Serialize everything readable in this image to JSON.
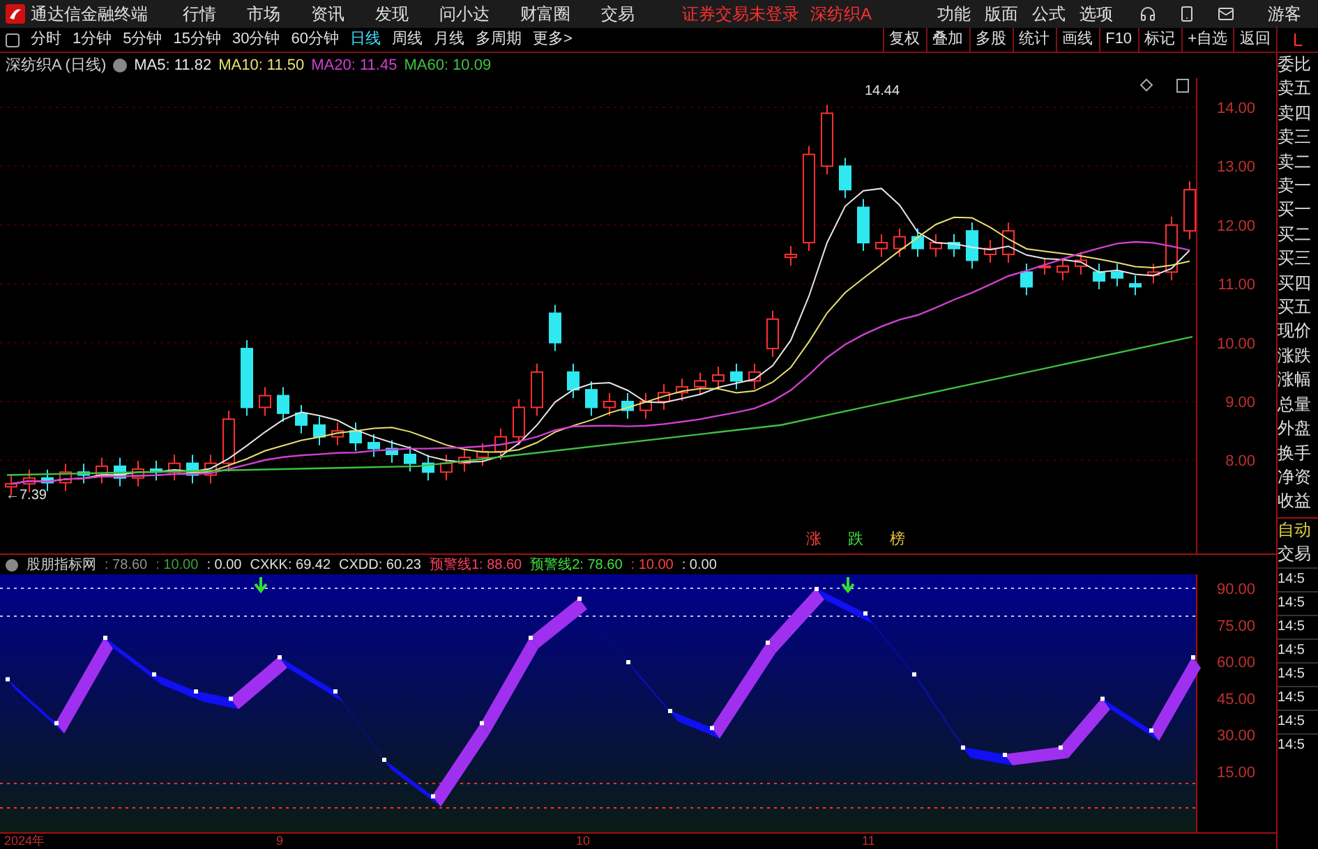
{
  "app": {
    "title": "通达信金融终端"
  },
  "menu": [
    "行情",
    "市场",
    "资讯",
    "发现",
    "问小达",
    "财富圈",
    "交易"
  ],
  "login_status": "证券交易未登录",
  "stock_name": "深纺织A",
  "top_actions": [
    "功能",
    "版面",
    "公式",
    "选项"
  ],
  "guest": "游客",
  "periods": [
    {
      "label": "分时",
      "selected": false
    },
    {
      "label": "1分钟",
      "selected": false
    },
    {
      "label": "5分钟",
      "selected": false
    },
    {
      "label": "15分钟",
      "selected": false
    },
    {
      "label": "30分钟",
      "selected": false
    },
    {
      "label": "60分钟",
      "selected": false
    },
    {
      "label": "日线",
      "selected": true
    },
    {
      "label": "周线",
      "selected": false
    },
    {
      "label": "月线",
      "selected": false
    },
    {
      "label": "多周期",
      "selected": false
    },
    {
      "label": "更多>",
      "selected": false
    }
  ],
  "chart_tools": [
    "复权",
    "叠加",
    "多股",
    "统计",
    "画线",
    "F10",
    "标记",
    "+自选",
    "返回"
  ],
  "mode_badge": "L",
  "price_chart": {
    "title": "深纺织A (日线)",
    "ma": [
      {
        "label": "MA5: 11.82",
        "color": "#e6e6e6"
      },
      {
        "label": "MA10: 11.50",
        "color": "#e8e070"
      },
      {
        "label": "MA20: 11.45",
        "color": "#d040d0"
      },
      {
        "label": "MA60: 10.09",
        "color": "#40c040"
      }
    ],
    "axis_labels": [
      "14.00",
      "13.00",
      "12.00",
      "11.00",
      "10.00",
      "9.00",
      "8.00"
    ],
    "high_label": "14.44",
    "low_label": "←7.39",
    "rank_labels": [
      {
        "text": "涨",
        "color": "#ff4040"
      },
      {
        "text": "跌",
        "color": "#40e040"
      },
      {
        "text": "榜",
        "color": "#e0c040"
      }
    ]
  },
  "indicator": {
    "name": "股朋指标网",
    "values": [
      {
        "text": ": 78.60",
        "color": "#909090"
      },
      {
        "text": ": 10.00",
        "color": "#40a040"
      },
      {
        "text": ": 0.00",
        "color": "#e0e0e0"
      },
      {
        "text": "CXKK: 69.42",
        "color": "#e0e0e0"
      },
      {
        "text": "CXDD: 60.23",
        "color": "#e0e0e0"
      },
      {
        "text": "预警线1: 88.60",
        "color": "#ff4060"
      },
      {
        "text": "预警线2: 78.60",
        "color": "#40e040"
      },
      {
        "text": ": 10.00",
        "color": "#ff4040"
      },
      {
        "text": ": 0.00",
        "color": "#e0e0e0"
      }
    ],
    "axis_labels": [
      "90.00",
      "75.00",
      "60.00",
      "45.00",
      "30.00",
      "15.00"
    ]
  },
  "date_axis": [
    "2024年",
    "9",
    "10",
    "11"
  ],
  "quote_panel": [
    "委比",
    "卖五",
    "卖四",
    "卖三",
    "卖二",
    "卖一",
    "买一",
    "买二",
    "买三",
    "买四",
    "买五",
    "现价",
    "涨跌",
    "涨幅",
    "总量",
    "外盘",
    "换手",
    "净资",
    "收益"
  ],
  "trade_panel": {
    "auto": "自动",
    "trade": "交易",
    "times": [
      "14:5",
      "14:5",
      "14:5",
      "14:5",
      "14:5",
      "14:5",
      "14:5",
      "14:5"
    ]
  }
}
